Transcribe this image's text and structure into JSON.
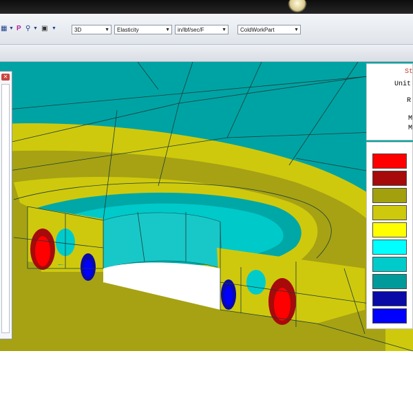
{
  "toolbar": {
    "icons": [
      "plot-icon",
      "dropdown-arrow-icon",
      "probe-icon",
      "filter-icon",
      "dropdown-arrow-icon",
      "clipboard-icon",
      "dropdown-arrow-icon"
    ],
    "view_mode": "3D",
    "analysis_type": "Elasticity",
    "units": "in/lbf/sec/F",
    "part_name": "ColdWorkPart"
  },
  "legend": {
    "line1": "St",
    "line2": "Unit",
    "line3": "R",
    "line4": "M",
    "line5": "M",
    "colors": [
      "#ff0000",
      "#a60a0a",
      "#a2a10d",
      "#cfc90d",
      "#ffff00",
      "#00ffff",
      "#00cbcb",
      "#009a9a",
      "#0a0aa6",
      "#0000ff"
    ]
  },
  "side_panel": {
    "close_glyph": "✕"
  }
}
